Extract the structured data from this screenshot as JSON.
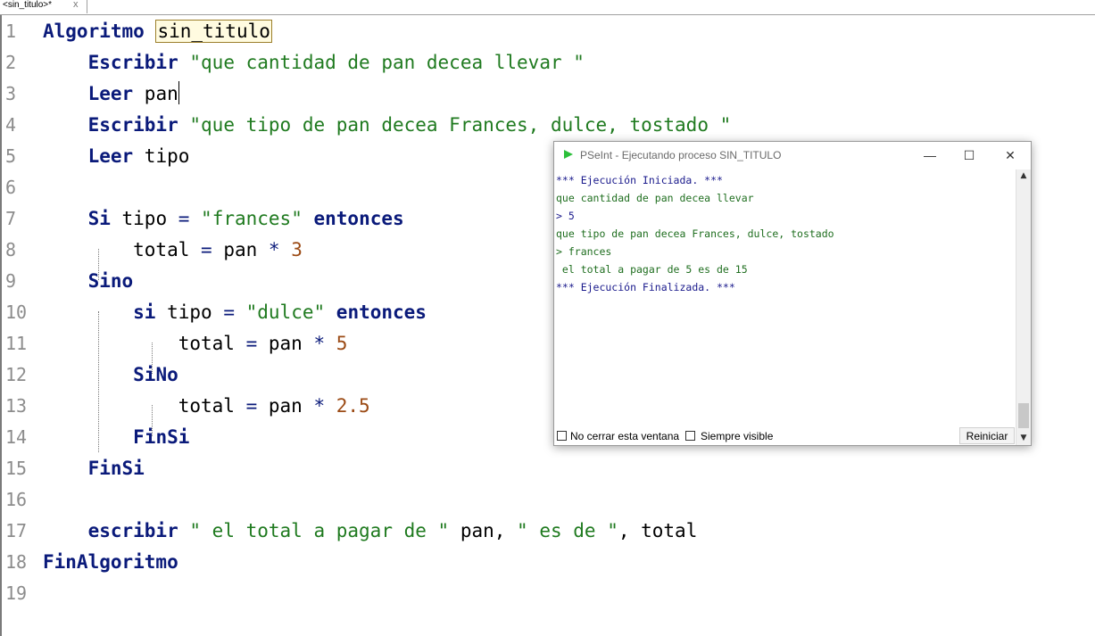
{
  "tab": {
    "label": "<sin_titulo>*",
    "close": "x"
  },
  "editor": {
    "lines": [
      {
        "n": "1",
        "parts": [
          {
            "t": "Algoritmo",
            "c": "kw"
          },
          {
            "t": " "
          },
          {
            "t": "sin_titulo",
            "c": "hl"
          }
        ]
      },
      {
        "n": "2",
        "parts": [
          {
            "t": "    "
          },
          {
            "t": "Escribir",
            "c": "kw"
          },
          {
            "t": " "
          },
          {
            "t": "\"que cantidad de pan decea llevar \"",
            "c": "str"
          }
        ]
      },
      {
        "n": "3",
        "parts": [
          {
            "t": "    "
          },
          {
            "t": "Leer",
            "c": "kw"
          },
          {
            "t": " pan"
          },
          {
            "t": "",
            "c": "caret"
          }
        ]
      },
      {
        "n": "4",
        "parts": [
          {
            "t": "    "
          },
          {
            "t": "Escribir",
            "c": "kw"
          },
          {
            "t": " "
          },
          {
            "t": "\"que tipo de pan decea Frances, dulce, tostado \"",
            "c": "str"
          }
        ]
      },
      {
        "n": "5",
        "parts": [
          {
            "t": "    "
          },
          {
            "t": "Leer",
            "c": "kw"
          },
          {
            "t": " tipo"
          }
        ]
      },
      {
        "n": "6",
        "parts": []
      },
      {
        "n": "7",
        "parts": [
          {
            "t": "    "
          },
          {
            "t": "Si",
            "c": "kw"
          },
          {
            "t": " tipo "
          },
          {
            "t": "=",
            "c": "op"
          },
          {
            "t": " "
          },
          {
            "t": "\"frances\"",
            "c": "str"
          },
          {
            "t": " "
          },
          {
            "t": "entonces",
            "c": "kw"
          }
        ]
      },
      {
        "n": "8",
        "parts": [
          {
            "t": "        total "
          },
          {
            "t": "=",
            "c": "op"
          },
          {
            "t": " pan "
          },
          {
            "t": "*",
            "c": "op"
          },
          {
            "t": " "
          },
          {
            "t": "3",
            "c": "num"
          }
        ]
      },
      {
        "n": "9",
        "parts": [
          {
            "t": "    "
          },
          {
            "t": "Sino",
            "c": "kw"
          }
        ]
      },
      {
        "n": "10",
        "parts": [
          {
            "t": "        "
          },
          {
            "t": "si",
            "c": "kw"
          },
          {
            "t": " tipo "
          },
          {
            "t": "=",
            "c": "op"
          },
          {
            "t": " "
          },
          {
            "t": "\"dulce\"",
            "c": "str"
          },
          {
            "t": " "
          },
          {
            "t": "entonces",
            "c": "kw"
          }
        ]
      },
      {
        "n": "11",
        "parts": [
          {
            "t": "            total "
          },
          {
            "t": "=",
            "c": "op"
          },
          {
            "t": " pan "
          },
          {
            "t": "*",
            "c": "op"
          },
          {
            "t": " "
          },
          {
            "t": "5",
            "c": "num"
          }
        ]
      },
      {
        "n": "12",
        "parts": [
          {
            "t": "        "
          },
          {
            "t": "SiNo",
            "c": "kw"
          }
        ]
      },
      {
        "n": "13",
        "parts": [
          {
            "t": "            total "
          },
          {
            "t": "=",
            "c": "op"
          },
          {
            "t": " pan "
          },
          {
            "t": "*",
            "c": "op"
          },
          {
            "t": " "
          },
          {
            "t": "2.5",
            "c": "num"
          }
        ]
      },
      {
        "n": "14",
        "parts": [
          {
            "t": "        "
          },
          {
            "t": "FinSi",
            "c": "kw"
          }
        ]
      },
      {
        "n": "15",
        "parts": [
          {
            "t": "    "
          },
          {
            "t": "FinSi",
            "c": "kw"
          }
        ]
      },
      {
        "n": "16",
        "parts": []
      },
      {
        "n": "17",
        "parts": [
          {
            "t": "    "
          },
          {
            "t": "escribir",
            "c": "kw"
          },
          {
            "t": " "
          },
          {
            "t": "\" el total a pagar de \"",
            "c": "str"
          },
          {
            "t": " pan, "
          },
          {
            "t": "\" es de \"",
            "c": "str"
          },
          {
            "t": ", total"
          }
        ]
      },
      {
        "n": "18",
        "parts": [
          {
            "t": "FinAlgoritmo",
            "c": "kw"
          }
        ]
      },
      {
        "n": "19",
        "parts": []
      }
    ]
  },
  "console_window": {
    "title": "PSeInt - Ejecutando proceso SIN_TITULO",
    "minimize": "—",
    "maximize": "☐",
    "close": "✕",
    "output": [
      {
        "text": "*** Ejecución Iniciada. ***",
        "c": "c-blue"
      },
      {
        "text": "que cantidad de pan decea llevar",
        "c": "c-green"
      },
      {
        "text": "> 5",
        "c": "c-blue"
      },
      {
        "text": "que tipo de pan decea Frances, dulce, tostado",
        "c": "c-green"
      },
      {
        "text": "> frances",
        "c": "c-olive"
      },
      {
        "text": " el total a pagar de 5 es de 15",
        "c": "c-green"
      },
      {
        "text": "*** Ejecución Finalizada. ***",
        "c": "c-blue"
      }
    ],
    "checkbox_keep_open": "No cerrar esta ventana",
    "checkbox_always_visible": "Siempre visible",
    "reset_button": "Reiniciar",
    "icon_color": "#2bbf3a"
  }
}
